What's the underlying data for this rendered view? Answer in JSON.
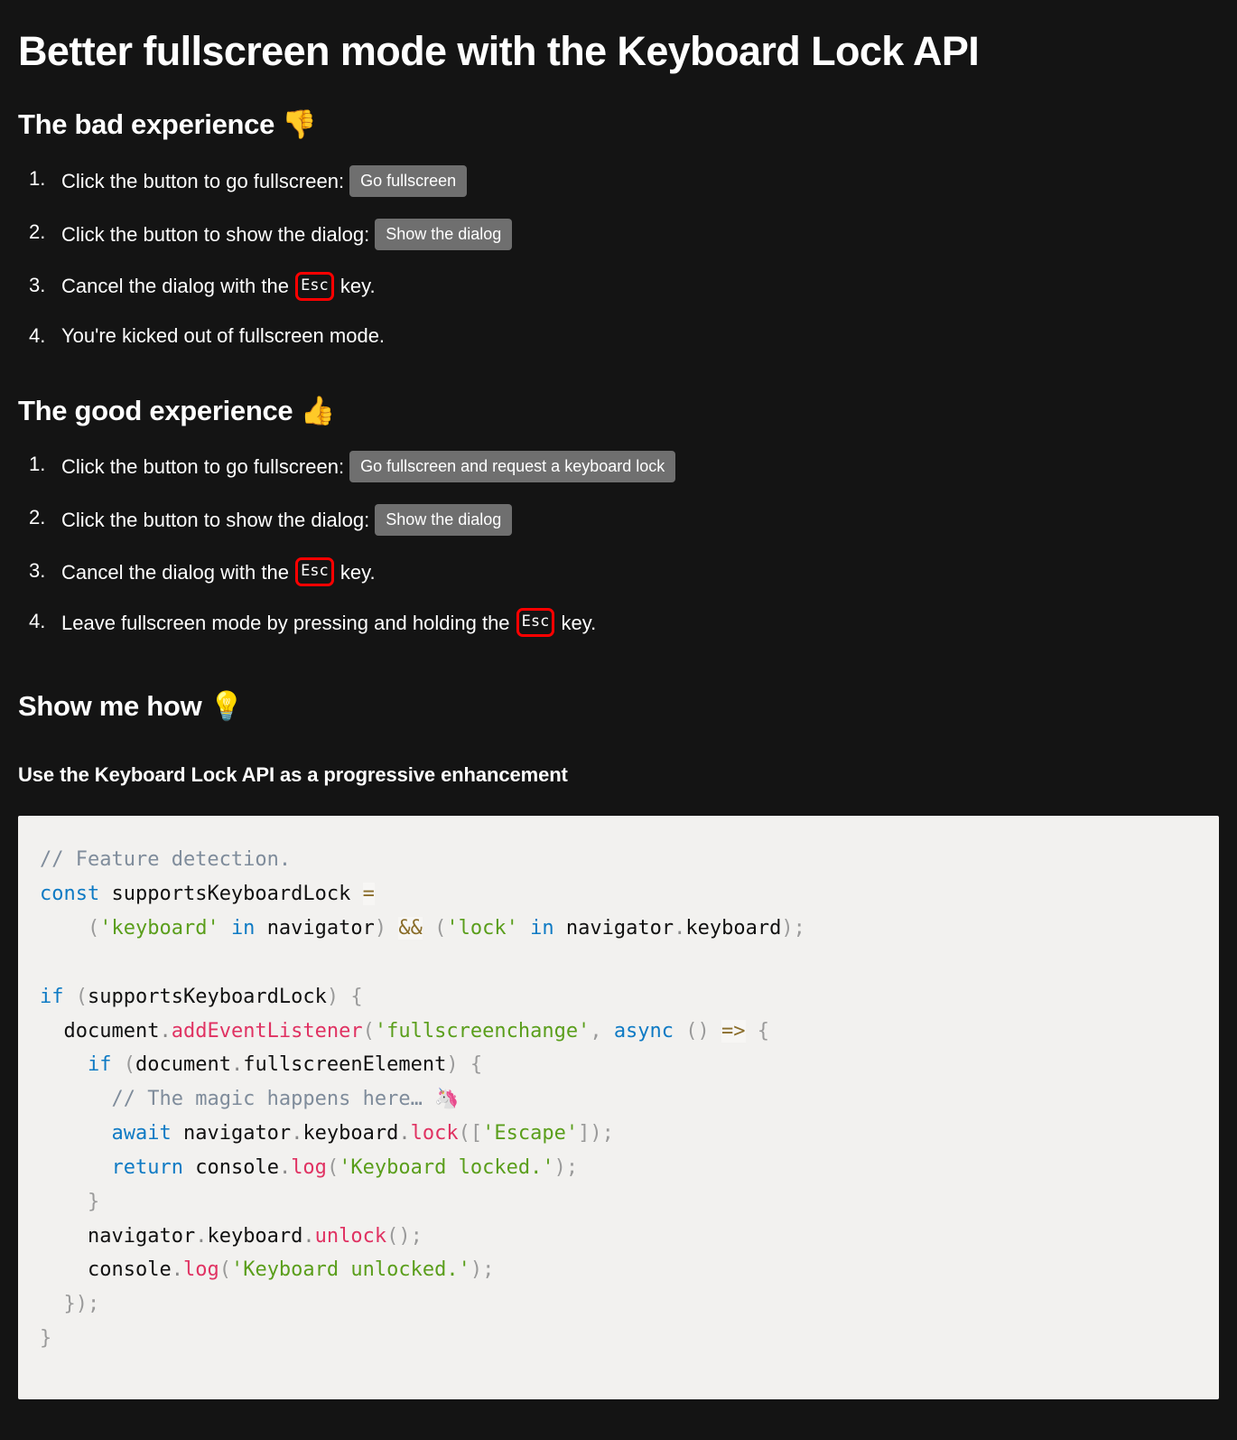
{
  "page": {
    "background": "#141414",
    "title": "Better fullscreen mode with the Keyboard Lock API"
  },
  "sections": {
    "bad": {
      "heading": "The bad experience",
      "heading_emoji": "👎",
      "steps": [
        {
          "text_before": "Click the button to go fullscreen:",
          "button": "Go fullscreen"
        },
        {
          "text_before": "Click the button to show the dialog:",
          "button": "Show the dialog"
        },
        {
          "text_before": "Cancel the dialog with the",
          "kbd": "Esc",
          "text_after": "key."
        },
        {
          "text_before": "You're kicked out of fullscreen mode."
        }
      ]
    },
    "good": {
      "heading": "The good experience",
      "heading_emoji": "👍",
      "steps": [
        {
          "text_before": "Click the button to go fullscreen:",
          "button": "Go fullscreen and request a keyboard lock"
        },
        {
          "text_before": "Click the button to show the dialog:",
          "button": "Show the dialog"
        },
        {
          "text_before": "Cancel the dialog with the",
          "kbd": "Esc",
          "text_after": "key."
        },
        {
          "text_before": "Leave fullscreen mode by pressing and holding the",
          "kbd": "Esc",
          "text_after": "key."
        }
      ]
    },
    "how": {
      "heading": "Show me how",
      "heading_emoji": "💡",
      "subheading": "Use the Keyboard Lock API as a progressive enhancement"
    }
  },
  "code": {
    "language": "javascript",
    "background": "#f2f1ef",
    "colors": {
      "comment": "#7f8c9b",
      "keyword": "#0e7ac4",
      "string": "#5a9e1b",
      "function": "#e03262",
      "operator": "#8a6d2a",
      "punctuation": "#9a9a9a",
      "plain": "#111111"
    },
    "lines": [
      "// Feature detection.",
      "const supportsKeyboardLock =",
      "    ('keyboard' in navigator) && ('lock' in navigator.keyboard);",
      "",
      "if (supportsKeyboardLock) {",
      "  document.addEventListener('fullscreenchange', async () => {",
      "    if (document.fullscreenElement) {",
      "      // The magic happens here… 🦄",
      "      await navigator.keyboard.lock(['Escape']);",
      "      return console.log('Keyboard locked.');",
      "    }",
      "    navigator.keyboard.unlock();",
      "    console.log('Keyboard unlocked.');",
      "  });",
      "}"
    ]
  },
  "theme": {
    "button_bg": "#6f6f6f",
    "kbd_border": "#ff0000",
    "text": "#ffffff"
  }
}
